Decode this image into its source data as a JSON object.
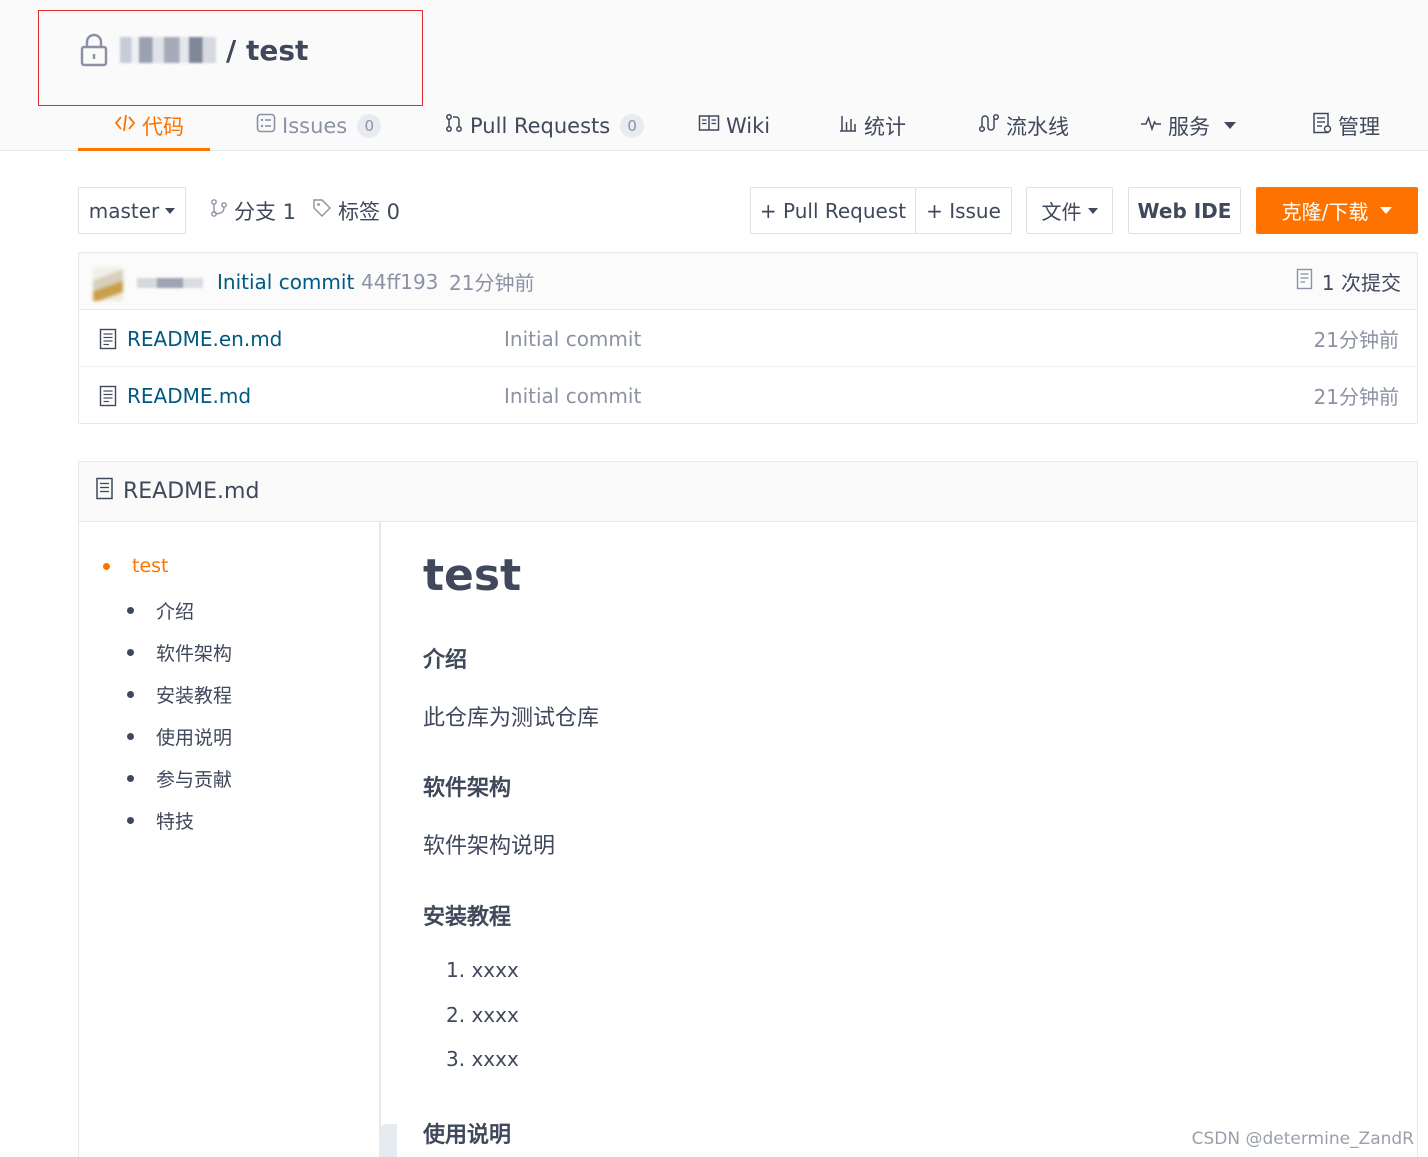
{
  "repo": {
    "title": "/ test"
  },
  "tabs": [
    {
      "label": "代码",
      "icon": "code-icon",
      "active": true
    },
    {
      "label": "Issues",
      "icon": "issues-icon",
      "count": "0"
    },
    {
      "label": "Pull Requests",
      "icon": "pull-request-icon",
      "count": "0"
    },
    {
      "label": "Wiki",
      "icon": "wiki-icon"
    },
    {
      "label": "统计",
      "icon": "stats-icon"
    },
    {
      "label": "流水线",
      "icon": "pipeline-icon"
    },
    {
      "label": "服务",
      "icon": "service-icon"
    },
    {
      "label": "管理",
      "icon": "manage-icon"
    }
  ],
  "toolbar": {
    "branch": "master",
    "branches": "分支 1",
    "tags": "标签 0",
    "new_pr": "+ Pull Request",
    "new_issue": "+ Issue",
    "file": "文件",
    "web_ide": "Web IDE",
    "clone": "克隆/下载"
  },
  "latest_commit": {
    "message": "Initial commit",
    "sha": "44ff193",
    "time": "21分钟前",
    "commit_count": "1 次提交"
  },
  "files": [
    {
      "name": "README.en.md",
      "message": "Initial commit",
      "time": "21分钟前"
    },
    {
      "name": "README.md",
      "message": "Initial commit",
      "time": "21分钟前"
    }
  ],
  "readme": {
    "filename": "README.md",
    "toc": [
      "test",
      "介绍",
      "软件架构",
      "安装教程",
      "使用说明",
      "参与贡献",
      "特技"
    ],
    "h1": "test",
    "intro_heading": "介绍",
    "intro_text": "此仓库为测试仓库",
    "arch_heading": "软件架构",
    "arch_text": "软件架构说明",
    "install_heading": "安装教程",
    "install_steps": [
      "1. xxxx",
      "2. xxxx",
      "3. xxxx"
    ],
    "usage_heading": "使用说明"
  },
  "watermark": "CSDN @determine_ZandR",
  "colors": {
    "accent": "#fe7300",
    "link": "#005980",
    "highlight": "#e02e2e"
  }
}
